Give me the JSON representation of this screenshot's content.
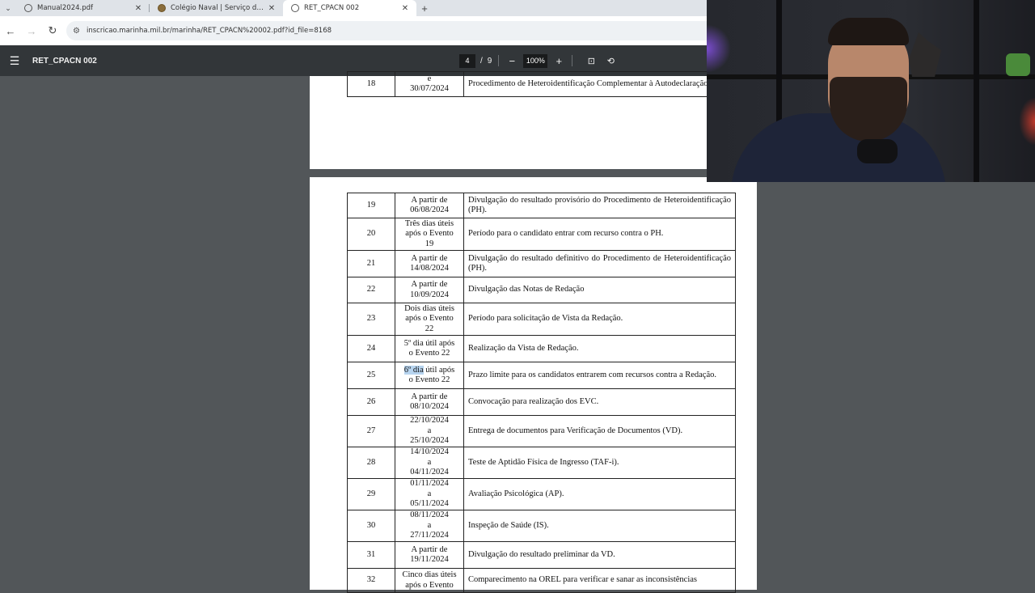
{
  "browser": {
    "tabs": [
      {
        "title": "Manual2024.pdf",
        "active": false
      },
      {
        "title": "Colégio Naval | Serviço de Seleção",
        "active": false
      },
      {
        "title": "RET_CPACN 002",
        "active": true
      }
    ],
    "new_tab_symbol": "+",
    "url": "inscricao.marinha.mil.br/marinha/RET_CPACN%20002.pdf?id_file=8168"
  },
  "pdf_viewer": {
    "doc_title": "RET_CPACN 002",
    "current_page": "4",
    "page_separator": "/",
    "total_pages": "9",
    "zoom": "100%"
  },
  "schedule_top": [
    {
      "num": "18",
      "date": [
        "e",
        "30/07/2024"
      ],
      "desc": "Procedimento de Heteroidentificação Complementar à Autodeclaração (PH)."
    }
  ],
  "schedule": [
    {
      "num": "19",
      "date": [
        "A partir de",
        "06/08/2024"
      ],
      "desc": "Divulgação do resultado provisório do Procedimento de Heteroidentificação (PH)."
    },
    {
      "num": "20",
      "date": [
        "Três dias úteis",
        "após o Evento",
        "19"
      ],
      "desc": "Período para o candidato entrar com recurso contra o PH."
    },
    {
      "num": "21",
      "date": [
        "A partir de",
        "14/08/2024"
      ],
      "desc": "Divulgação do resultado definitivo do Procedimento de Heteroidentificação (PH)."
    },
    {
      "num": "22",
      "date": [
        "A partir de",
        "10/09/2024"
      ],
      "desc": "Divulgação das Notas de Redação"
    },
    {
      "num": "23",
      "date": [
        "Dois dias úteis",
        "após o Evento",
        "22"
      ],
      "desc": "Período para solicitação de Vista da Redação."
    },
    {
      "num": "24",
      "date": [
        "5º dia útil após",
        "o Evento 22"
      ],
      "desc": "Realização da Vista de Redação."
    },
    {
      "num": "25",
      "date": [
        "6º dia útil após",
        "o Evento 22"
      ],
      "desc": "Prazo limite para os candidatos entrarem com recursos contra a Redação."
    },
    {
      "num": "26",
      "date": [
        "A partir de",
        "08/10/2024"
      ],
      "desc": "Convocação para realização dos EVC."
    },
    {
      "num": "27",
      "date": [
        "22/10/2024",
        "a",
        "25/10/2024"
      ],
      "desc": "Entrega de documentos para Verificação de Documentos (VD)."
    },
    {
      "num": "28",
      "date": [
        "14/10/2024",
        "a",
        "04/11/2024"
      ],
      "desc": "Teste de Aptidão Física de Ingresso (TAF-i)."
    },
    {
      "num": "29",
      "date": [
        "01/11/2024",
        "a",
        "05/11/2024"
      ],
      "desc": "Avaliação Psicológica (AP)."
    },
    {
      "num": "30",
      "date": [
        "08/11/2024",
        "a",
        "27/11/2024"
      ],
      "desc": "Inspeção de Saúde (IS)."
    },
    {
      "num": "31",
      "date": [
        "A partir de",
        "19/11/2024"
      ],
      "desc": "Divulgação do resultado preliminar da VD."
    },
    {
      "num": "32",
      "date": [
        "Cinco dias úteis",
        "após o Evento"
      ],
      "desc": "Comparecimento na OREL para verificar e sanar as inconsistências"
    }
  ],
  "icons": {
    "tab_list": "chevron-down-icon",
    "globe": "globe-icon",
    "back": "back-arrow-icon",
    "forward": "forward-arrow-icon",
    "reload": "reload-icon",
    "site_info": "site-info-icon",
    "menu": "hamburger-menu-icon",
    "zoom_out": "minus-icon",
    "zoom_in": "plus-icon",
    "fit": "fit-page-icon",
    "rotate": "rotate-icon"
  }
}
